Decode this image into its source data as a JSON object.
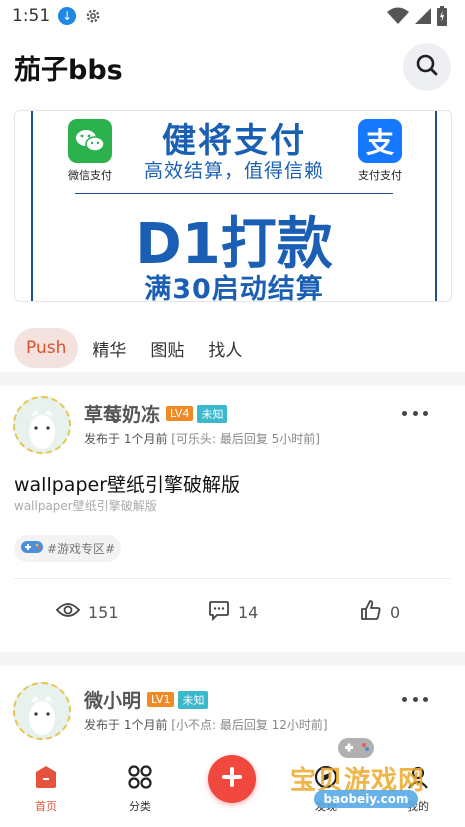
{
  "status_bar": {
    "time": "1:51"
  },
  "header": {
    "title": "茄子bbs"
  },
  "banner": {
    "headline": "健将支付",
    "subline": "高效结算，值得信赖",
    "big_text": "D1打款",
    "bottom_text": "满30启动结算",
    "left_logo_caption": "微信支付",
    "right_logo_caption": "支付宝",
    "right_logo_caption_full": "支付支付",
    "right_logo_glyph": "支"
  },
  "tabs": [
    {
      "label": "Push",
      "active": true
    },
    {
      "label": "精华",
      "active": false
    },
    {
      "label": "图贴",
      "active": false
    },
    {
      "label": "找人",
      "active": false
    }
  ],
  "posts": [
    {
      "author": "草莓奶冻",
      "level": "LV4",
      "tag": "未知",
      "posted": "发布于 1个月前",
      "reply_info": "[可乐头: 最后回复 5小时前]",
      "title": "wallpaper壁纸引擎破解版",
      "subtitle": "wallpaper壁纸引擎破解版",
      "topic": "#游戏专区#",
      "views": "151",
      "comments": "14",
      "likes": "0"
    },
    {
      "author": "微小明",
      "level": "LV1",
      "tag": "未知",
      "posted": "发布于 1个月前",
      "reply_info": "[小不点: 最后回复 12小时前]"
    }
  ],
  "bottom_nav": {
    "items": [
      {
        "label": "首页",
        "icon": "home-icon",
        "active": true
      },
      {
        "label": "分类",
        "icon": "grid-icon",
        "active": false
      },
      {
        "label": "发现",
        "icon": "compass-icon",
        "active": false
      },
      {
        "label": "我的",
        "icon": "user-icon",
        "active": false
      }
    ],
    "fab_icon": "plus-icon"
  },
  "watermark": {
    "text": "宝贝游戏网",
    "url": "baobeiy.com"
  },
  "colors": {
    "accent": "#e5533c",
    "fab": "#f0473e",
    "banner_blue": "#1a5fb4",
    "level_badge": "#f08a24",
    "tag_badge": "#3bb8cc"
  }
}
